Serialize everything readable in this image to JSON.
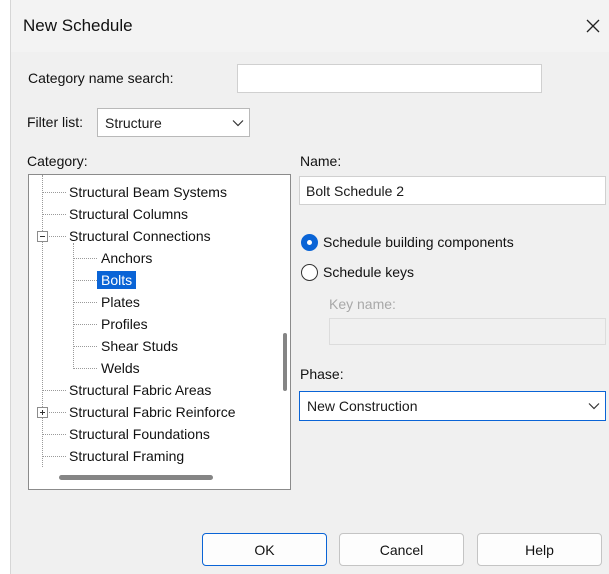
{
  "window": {
    "title": "New Schedule"
  },
  "search": {
    "label": "Category name search:",
    "value": ""
  },
  "filter": {
    "label": "Filter list:",
    "value": "Structure"
  },
  "category": {
    "label": "Category:",
    "items": [
      {
        "label": "Structural Beam Systems"
      },
      {
        "label": "Structural Columns"
      },
      {
        "label": "Structural Connections"
      },
      {
        "label": "Anchors"
      },
      {
        "label": "Bolts"
      },
      {
        "label": "Plates"
      },
      {
        "label": "Profiles"
      },
      {
        "label": "Shear Studs"
      },
      {
        "label": "Welds"
      },
      {
        "label": "Structural Fabric Areas"
      },
      {
        "label": "Structural Fabric Reinforce"
      },
      {
        "label": "Structural Foundations"
      },
      {
        "label": "Structural Framing"
      }
    ]
  },
  "name": {
    "label": "Name:",
    "value": "Bolt Schedule 2"
  },
  "schedule_type": {
    "options": [
      {
        "label": "Schedule building components",
        "checked": true
      },
      {
        "label": "Schedule keys",
        "checked": false
      }
    ],
    "key_name_label": "Key name:",
    "key_name_value": ""
  },
  "phase": {
    "label": "Phase:",
    "value": "New Construction"
  },
  "buttons": {
    "ok": "OK",
    "cancel": "Cancel",
    "help": "Help"
  },
  "colors": {
    "accent": "#0a64d6",
    "selection": "#0a64d6"
  }
}
